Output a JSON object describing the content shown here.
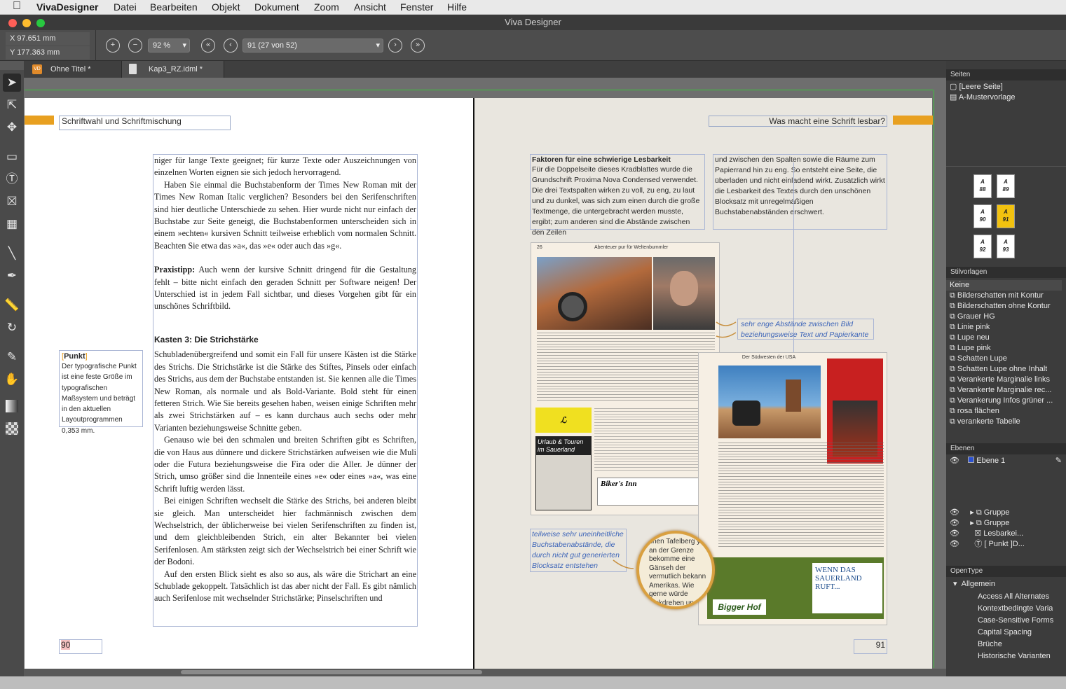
{
  "menubar": {
    "apple": "",
    "app": "VivaDesigner",
    "items": [
      "Datei",
      "Bearbeiten",
      "Objekt",
      "Dokument",
      "Zoom",
      "Ansicht",
      "Fenster",
      "Hilfe"
    ]
  },
  "window": {
    "title": "Viva Designer"
  },
  "toolbar": {
    "x": "X  97.651 mm",
    "y": "Y  177.363 mm",
    "zoom": "92 %",
    "page": "91 (27 von 52)"
  },
  "tabs": [
    {
      "label": "Ohne Titel *"
    },
    {
      "label": "Kap3_RZ.idml *"
    }
  ],
  "left": {
    "header": "Schriftwahl und Schriftmischung",
    "p1": "niger für lange Texte geeignet; für kurze Texte oder Auszeichnungen von einzelnen Worten eignen sie sich jedoch hervorragend.",
    "p2": "Haben Sie einmal die Buchstabenform der Times New Roman mit der Times New Roman Italic verglichen? Besonders bei den Serifenschriften sind hier deutliche Unterschiede zu sehen. Hier wurde nicht nur einfach der Buchstabe zur Seite geneigt, die Buchstabenformen unterscheiden sich in einem »echten« kursiven Schnitt teilweise erheblich vom normalen Schnitt. Beachten Sie etwa das »a«, das »e« oder auch das »g«.",
    "tipp_label": "Praxistipp:",
    "tipp": "Auch wenn der kursive Schnitt dringend für die Gestaltung fehlt – bitte nicht einfach den geraden Schnitt per Software neigen! Der Unterschied ist in jedem Fall sichtbar, und dieses Vorgehen gibt für ein unschönes Schriftbild.",
    "h3": "Kasten 3: Die Strichstärke",
    "p3": "Schubladenübergreifend und somit ein Fall für unsere Kästen ist die Stärke des Strichs. Die Strichstärke ist die Stärke des Stiftes, Pinsels oder einfach des Strichs, aus dem der Buchstabe entstanden ist. Sie kennen alle die Times New Roman, als normale und als Bold-Variante. Bold steht für einen fetteren Strich. Wie Sie bereits gesehen haben, weisen einige Schriften mehr als zwei Strichstärken auf – es kann durchaus auch sechs oder mehr Varianten beziehungsweise Schnitte geben.",
    "p4": "Genauso wie bei den schmalen und breiten Schriften gibt es Schriften, die von Haus aus dünnere und dickere Strichstärken aufweisen wie die Muli oder die Futura beziehungsweise die Fira oder die Aller. Je dünner der Strich, umso größer sind die Innenteile eines »e« oder eines »a«, was eine Schrift luftig werden lässt.",
    "p5": "Bei einigen Schriften wechselt die Stärke des Strichs, bei anderen bleibt sie gleich. Man unterscheidet hier fachmännisch zwischen dem Wechselstrich, der üblicherweise bei vielen Serifenschriften zu finden ist, und dem gleichbleibenden Strich, ein alter Bekannter bei vielen Serifenlosen. Am stärksten zeigt sich der Wechselstrich bei einer Schrift wie der Bodoni.",
    "p6": "Auf den ersten Blick sieht es also so aus, als wäre die Strichart an eine Schublade gekoppelt. Tatsächlich ist das aber nicht der Fall. Es gibt nämlich auch Serifenlose mit wechselnder Strichstärke; Pinselschriften und",
    "side_title": "Punkt",
    "side_text": "Der typografische Punkt ist eine feste Größe im typografischen Maßsystem und beträgt in den aktuellen Layoutprogrammen 0,353 mm.",
    "pagenum": "90"
  },
  "right": {
    "header": "Was macht eine Schrift lesbar?",
    "h": "Faktoren für eine schwierige Lesbarkeit",
    "col1": "Für die Doppelseite dieses Kradblattes wurde die Grundschrift Proxima Nova Condensed verwendet. Die drei Textspalten wirken zu voll, zu eng, zu laut und zu dunkel, was sich zum einen durch die große Textmenge, die untergebracht werden musste, ergibt; zum anderen sind die Abstände zwischen den Zeilen",
    "col2": "und zwischen den Spalten sowie die Räume zum Papierrand hin zu eng. So entsteht eine Seite, die überladen und nicht einladend wirkt. Zusätzlich wirkt die Lesbarkeit des Textes durch den unschönen Blocksatz mit unregelmäßigen Buchstabenabständen erschwert.",
    "anno1": "sehr enge Abstände zwischen Bild beziehungsweise Text und Papierkante",
    "anno2": "teilweise sehr uneinheitliche Buchstabenabstände, die durch nicht gut generierten Blocksatz entstehen",
    "mag_head": "Abenteuer pur für Weltenbummler",
    "mag_num": "26",
    "mag2_head": "Der Südwesten der USA",
    "ad1": "Urlaub & Touren im Sauerland",
    "ad2": "Biker's Inn",
    "ad3": "Bigger Hof",
    "ad4": "WENN DAS SAUERLAND RUFT...",
    "lupe": "chen Tafelberg y an der Grenze bekomme eine Gänseh der vermutlich bekann Amerikas. Wie gerne würde rückdrehen und die vergan ochen noch einmal erlebe ise endet ja noch weiter n in einen weiteren Colorado.",
    "pagenum": "91"
  },
  "panel": {
    "seiten": "Seiten",
    "seiten_items": [
      "[Leere Seite]",
      "A-Mustervorlage"
    ],
    "thumbs": [
      {
        "m": "A",
        "n": "88"
      },
      {
        "m": "A",
        "n": "89"
      },
      {
        "m": "A",
        "n": "90"
      },
      {
        "m": "A",
        "n": "91"
      },
      {
        "m": "A",
        "n": "92"
      },
      {
        "m": "A",
        "n": "93"
      }
    ],
    "stil": "Stilvorlagen",
    "stil_items": [
      "Keine",
      "Bilderschatten mit Kontur",
      "Bilderschatten ohne Kontur",
      "Grauer HG",
      "Linie pink",
      "Lupe neu",
      "Lupe pink",
      "Schatten Lupe",
      "Schatten Lupe ohne Inhalt",
      "Verankerte Marginalie links",
      "Verankerte Marginalie rec...",
      "Verankerung Infos grüner ...",
      "rosa flächen",
      "verankerte Tabelle"
    ],
    "ebenen": "Ebenen",
    "ebene1": "Ebene 1",
    "objects": [
      "Gruppe",
      "Gruppe",
      "Lesbarkei...",
      "[ Punkt ]D..."
    ],
    "opentype": "OpenType",
    "ot_group": "Allgemein",
    "ot_items": [
      "Access All Alternates",
      "Kontextbedingte Varia",
      "Case-Sensitive Forms",
      "Capital Spacing",
      "Brüche",
      "Historische Varianten"
    ]
  },
  "colors": {
    "accent": "#e8a020",
    "guide": "#3cc43c",
    "frame": "#8fa4cf",
    "selected": "#f2c20f"
  }
}
